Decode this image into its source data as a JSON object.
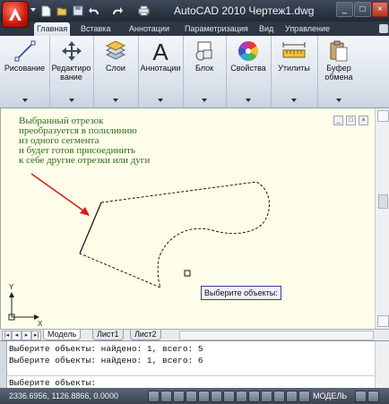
{
  "window": {
    "title": "AutoCAD 2010    Чертеж1.dwg"
  },
  "titlebar": {
    "quick_access": [
      "new-icon",
      "open-icon",
      "save-icon",
      "undo-icon",
      "redo-icon",
      "print-icon"
    ],
    "window_buttons": [
      "_",
      "□",
      "×"
    ]
  },
  "ribbon": {
    "tabs": [
      {
        "label": "Главная",
        "active": true
      },
      {
        "label": "Вставка"
      },
      {
        "label": "Аннотации"
      },
      {
        "label": "Параметризация"
      },
      {
        "label": "Вид"
      },
      {
        "label": "Управление"
      }
    ],
    "panels": [
      {
        "label": "Рисование",
        "icon": "line-draw-icon"
      },
      {
        "label": "Редактиро\nвание",
        "icon": "move-arrows-icon"
      },
      {
        "label": "Слои",
        "icon": "layers-icon"
      },
      {
        "label": "Аннотации",
        "icon": "text-a-icon"
      },
      {
        "label": "Блок",
        "icon": "block-icon"
      },
      {
        "label": "Свойства",
        "icon": "color-wheel-icon"
      },
      {
        "label": "Утилиты",
        "icon": "measure-icon"
      },
      {
        "label": "Буфер\nобмена",
        "icon": "clipboard-icon"
      }
    ]
  },
  "drawing": {
    "annotation_lines": [
      "Выбранный отрезок",
      "преобразуется в полилинию",
      "из одного сегмента",
      "и будет готов присоединить",
      "к себе другие отрезки или дуги"
    ],
    "tooltip": "Выберите объекты:",
    "ucs": {
      "x_label": "X",
      "y_label": "Y"
    },
    "colors": {
      "background": "#fdfde9",
      "annotation_text": "#2e6b1b",
      "arrow": "#d8201a"
    }
  },
  "layout_tabs": {
    "tabs": [
      {
        "label": "Модель",
        "active": true
      },
      {
        "label": "Лист1"
      },
      {
        "label": "Лист2"
      }
    ]
  },
  "command_line": {
    "history": [
      "Выберите объекты: найдено: 1, всего: 5",
      "Выберите объекты: найдено: 1, всего: 6"
    ],
    "prompt": "Выберите объекты:"
  },
  "status_bar": {
    "coordinates": "2336.6956, 1126.8866, 0.0000",
    "space": "МОДЕЛЬ"
  }
}
